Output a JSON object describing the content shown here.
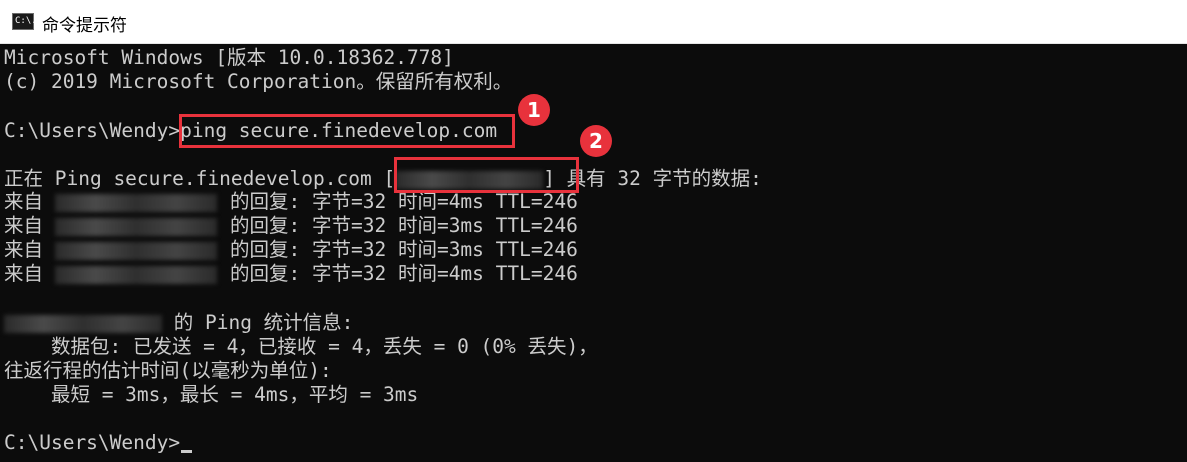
{
  "window": {
    "title": "命令提示符",
    "icon": "cmd-icon",
    "icon_text": "C:\\."
  },
  "console": {
    "header1": "Microsoft Windows [版本 10.0.18362.778]",
    "header2": "(c) 2019 Microsoft Corporation。保留所有权利。",
    "prompt": "C:\\Users\\Wendy>",
    "command": "ping secure.finedevelop.com",
    "ping_prefix": "正在 Ping secure.finedevelop.com [",
    "ping_suffix": "] 具有 32 字节的数据:",
    "replies": [
      {
        "prefix": "来自",
        "text": "的回复: 字节=32 时间=4ms TTL=246"
      },
      {
        "prefix": "来自",
        "text": "的回复: 字节=32 时间=3ms TTL=246"
      },
      {
        "prefix": "来自",
        "text": "的回复: 字节=32 时间=3ms TTL=246"
      },
      {
        "prefix": "来自",
        "text": "的回复: 字节=32 时间=4ms TTL=246"
      }
    ],
    "stats_title": " 的 Ping 统计信息:",
    "packets": "    数据包: 已发送 = 4，已接收 = 4，丢失 = 0 (0% 丢失)，",
    "rtt_title": "往返行程的估计时间(以毫秒为单位):",
    "rtt": "    最短 = 3ms，最长 = 4ms，平均 = 3ms",
    "final_prompt": "C:\\Users\\Wendy>"
  },
  "annotations": {
    "marker1": "1",
    "marker2": "2",
    "color": "#e8323c"
  }
}
